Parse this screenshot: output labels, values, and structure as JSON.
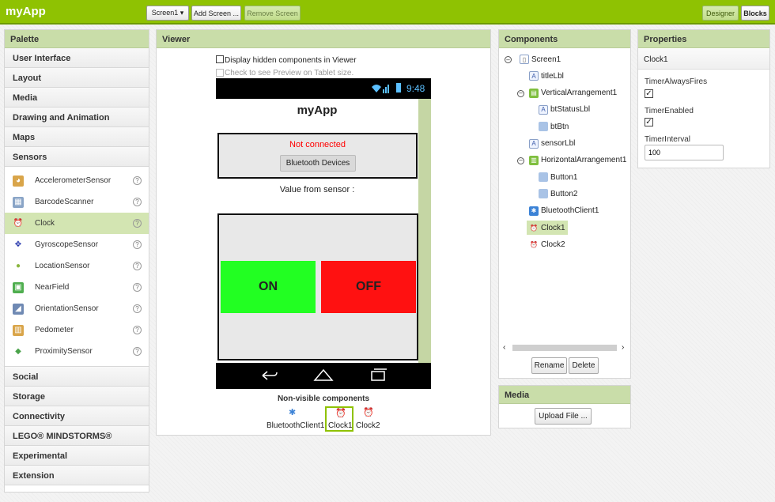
{
  "app": {
    "title": "myApp"
  },
  "toolbar": {
    "screen_select": "Screen1 ▾",
    "add_screen": "Add Screen ...",
    "remove_screen": "Remove Screen",
    "designer": "Designer",
    "blocks": "Blocks"
  },
  "palette": {
    "title": "Palette",
    "top_categories": [
      "User Interface",
      "Layout",
      "Media",
      "Drawing and Animation",
      "Maps",
      "Sensors"
    ],
    "sensors": [
      {
        "label": "AccelerometerSensor",
        "icon": "accelerometer-icon"
      },
      {
        "label": "BarcodeScanner",
        "icon": "barcode-icon"
      },
      {
        "label": "Clock",
        "icon": "clock-icon"
      },
      {
        "label": "GyroscopeSensor",
        "icon": "gyroscope-icon"
      },
      {
        "label": "LocationSensor",
        "icon": "location-icon"
      },
      {
        "label": "NearField",
        "icon": "nfc-icon"
      },
      {
        "label": "OrientationSensor",
        "icon": "orientation-icon"
      },
      {
        "label": "Pedometer",
        "icon": "pedometer-icon"
      },
      {
        "label": "ProximitySensor",
        "icon": "proximity-icon"
      }
    ],
    "help_glyph": "?",
    "bottom_categories": [
      "Social",
      "Storage",
      "Connectivity",
      "LEGO® MINDSTORMS®",
      "Experimental",
      "Extension"
    ]
  },
  "viewer": {
    "title": "Viewer",
    "hidden_checkbox_label": "Display hidden components in Viewer",
    "tablet_checkbox_label": "Check to see Preview on Tablet size.",
    "status_time": "9:48",
    "screen_title": "myApp",
    "status_text": "Not connected",
    "bt_button": "Bluetooth Devices",
    "sensor_label": "Value from sensor :",
    "on_button": "ON",
    "off_button": "OFF",
    "nonvisible_title": "Non-visible components",
    "nonvisible": [
      "BluetoothClient1",
      "Clock1",
      "Clock2"
    ]
  },
  "components": {
    "title": "Components",
    "tree": [
      "Screen1",
      "titleLbl",
      "VerticalArrangement1",
      "btStatusLbl",
      "btBtn",
      "sensorLbl",
      "HorizontalArrangement1",
      "Button1",
      "Button2",
      "BluetoothClient1",
      "Clock1",
      "Clock2"
    ],
    "rename": "Rename",
    "delete": "Delete"
  },
  "media": {
    "title": "Media",
    "upload": "Upload File ..."
  },
  "properties": {
    "title": "Properties",
    "component": "Clock1",
    "always_fires_label": "TimerAlwaysFires",
    "always_fires": true,
    "enabled_label": "TimerEnabled",
    "enabled": true,
    "interval_label": "TimerInterval",
    "interval_value": "100"
  },
  "colors": {
    "accent": "#8fc202",
    "on": "#22ff22",
    "off": "#ff1111",
    "status_text": "#ff0000"
  }
}
